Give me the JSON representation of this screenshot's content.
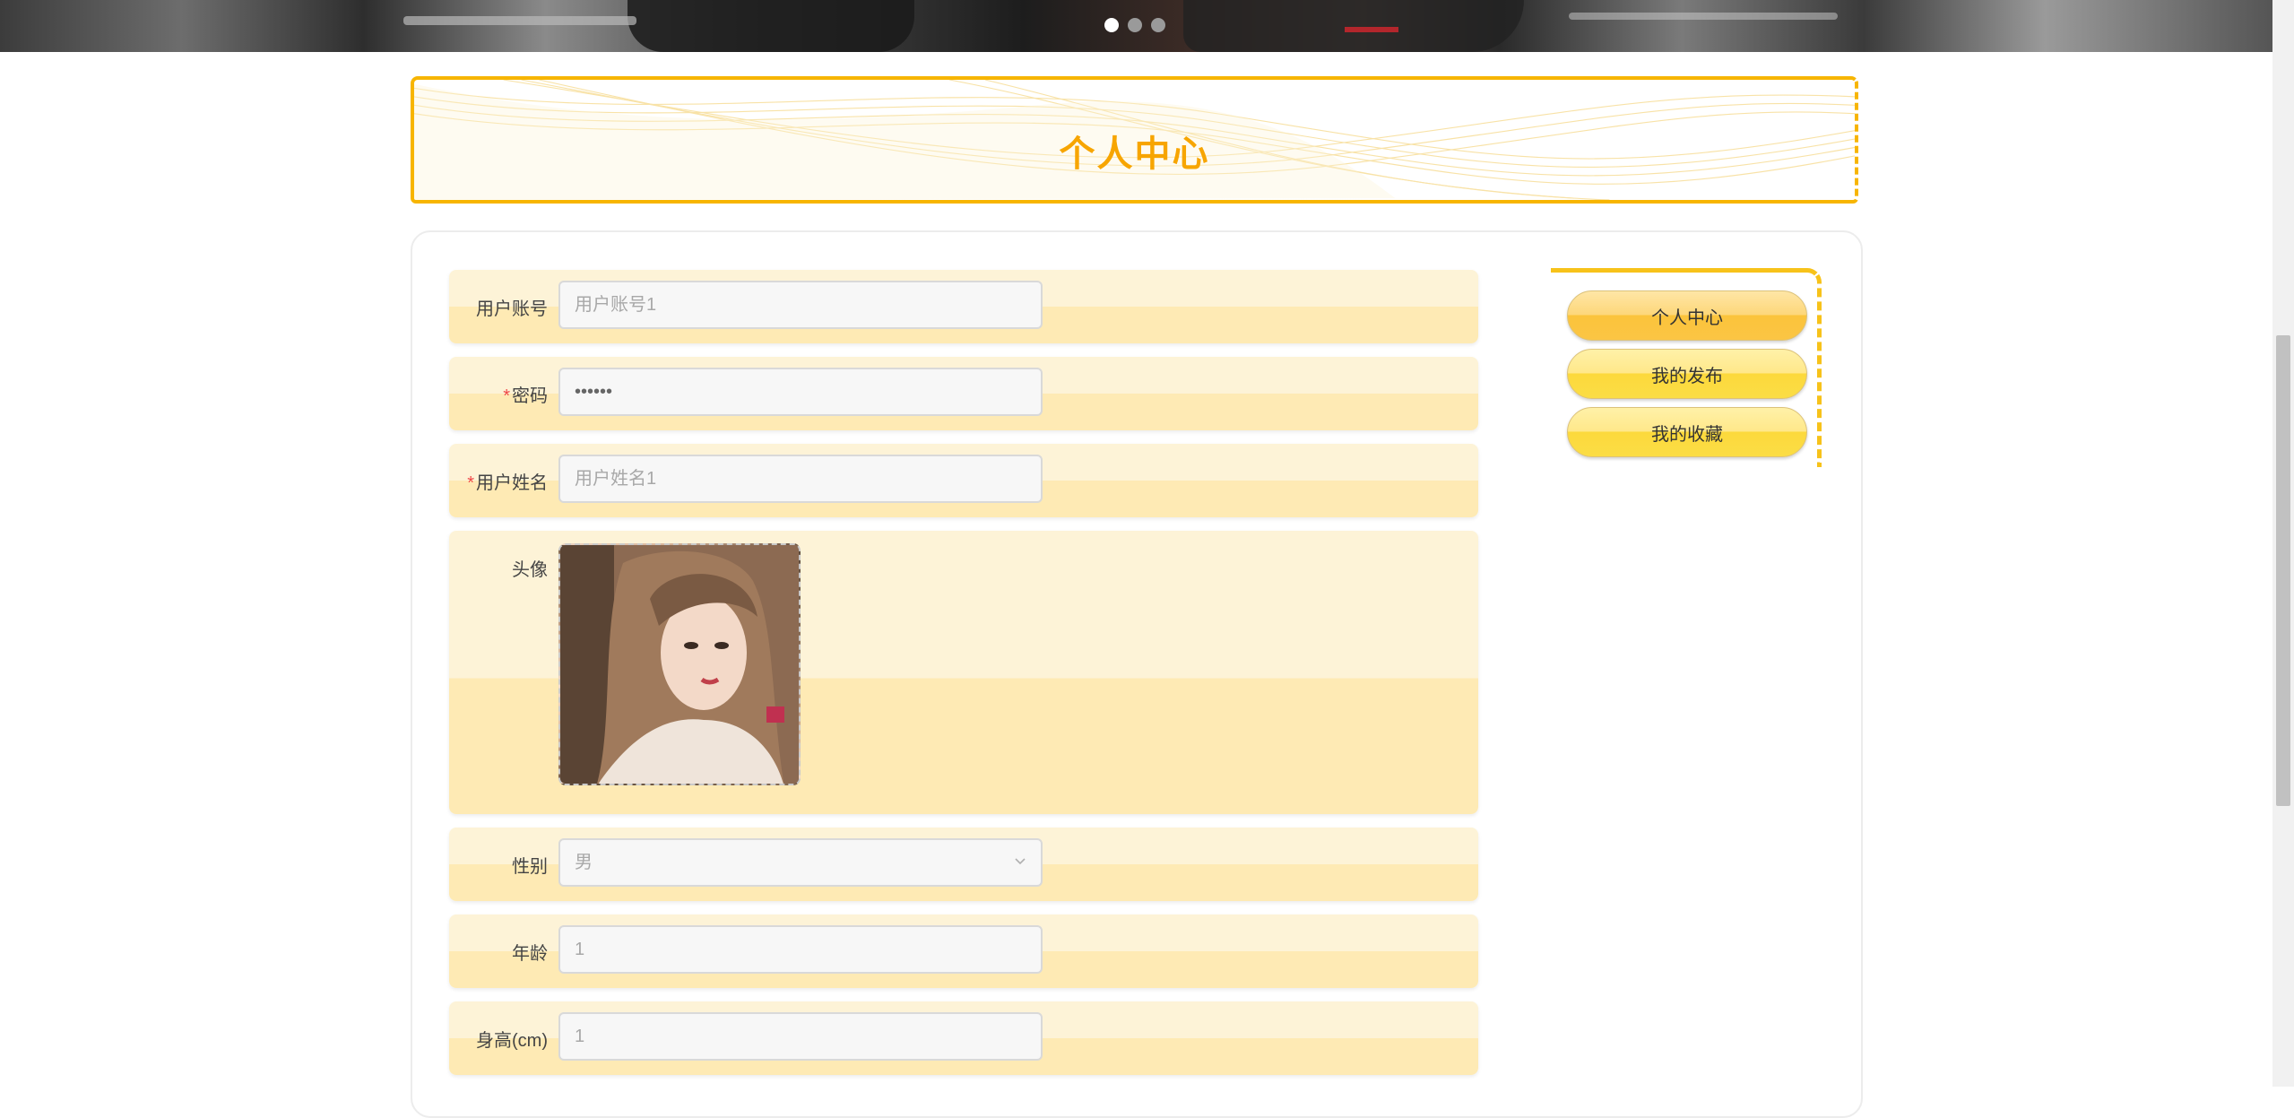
{
  "banner": {
    "carousel_dots": 3,
    "active_dot": 0
  },
  "header": {
    "title": "个人中心"
  },
  "form": {
    "account": {
      "label": "用户账号",
      "value": "",
      "placeholder": "用户账号1"
    },
    "password": {
      "label": "密码",
      "value": "••••••",
      "required": true
    },
    "name": {
      "label": "用户姓名",
      "value": "",
      "placeholder": "用户姓名1",
      "required": true
    },
    "avatar": {
      "label": "头像"
    },
    "gender": {
      "label": "性别",
      "value": "男"
    },
    "age": {
      "label": "年龄",
      "value": "1"
    },
    "height": {
      "label": "身高(cm)",
      "value": "1"
    }
  },
  "side_menu": {
    "items": [
      {
        "label": "个人中心",
        "active": true
      },
      {
        "label": "我的发布",
        "active": false
      },
      {
        "label": "我的收藏",
        "active": false
      }
    ]
  },
  "colors": {
    "accent": "#f7b500",
    "title": "#f7a500",
    "row_light": "#fdf3d7",
    "row_dark": "#feeab4",
    "required": "#f04848"
  }
}
